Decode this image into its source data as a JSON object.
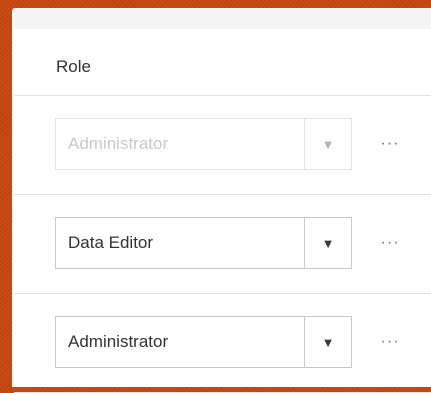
{
  "column_header": "Role",
  "rows": [
    {
      "role": "Administrator",
      "disabled": true
    },
    {
      "role": "Data Editor",
      "disabled": false
    },
    {
      "role": "Administrator",
      "disabled": false
    }
  ],
  "icons": {
    "dropdown": "chevron-down-icon",
    "more": "ellipsis-icon"
  },
  "glyphs": {
    "arrow": "▼",
    "more": "···"
  }
}
